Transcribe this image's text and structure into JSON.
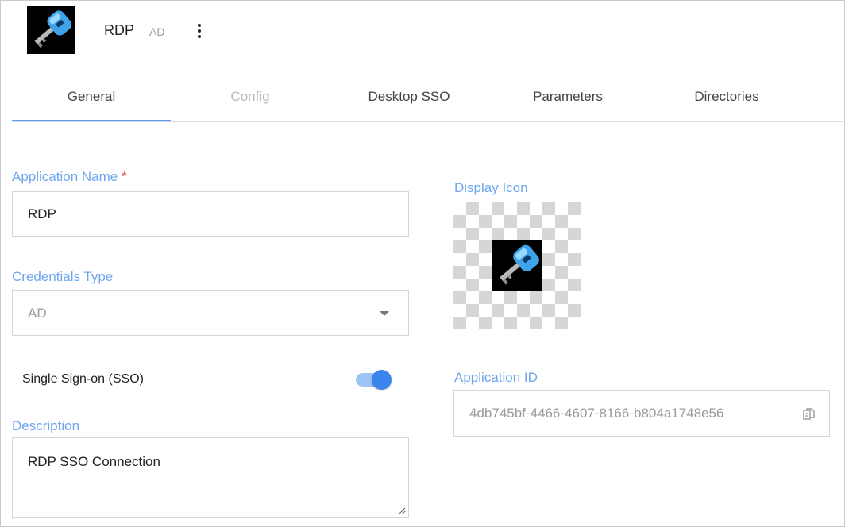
{
  "header": {
    "title": "RDP",
    "subtitle": "AD",
    "logo_icon": "key-icon",
    "menu_icon": "more-vertical-icon"
  },
  "tabs": [
    {
      "label": "General",
      "active": true,
      "disabled": false
    },
    {
      "label": "Config",
      "active": false,
      "disabled": true
    },
    {
      "label": "Desktop SSO",
      "active": false,
      "disabled": false
    },
    {
      "label": "Parameters",
      "active": false,
      "disabled": false
    },
    {
      "label": "Directories",
      "active": false,
      "disabled": false
    }
  ],
  "form": {
    "app_name_label": "Application Name",
    "required_mark": "*",
    "app_name_value": "RDP",
    "credentials_type_label": "Credentials Type",
    "credentials_type_value": "AD",
    "sso_label": "Single Sign-on (SSO)",
    "sso_enabled": true,
    "description_label": "Description",
    "description_value": "RDP SSO Connection",
    "display_icon_label": "Display Icon",
    "display_icon": "key-icon",
    "application_id_label": "Application ID",
    "application_id_value": "4db745bf-4466-4607-8166-b804a1748e56",
    "copy_icon": "copy-icon"
  },
  "colors": {
    "accent": "#5b9cf0",
    "label": "#6ea6ee",
    "required": "#e04b4b",
    "toggle_on": "#3b84ee"
  }
}
